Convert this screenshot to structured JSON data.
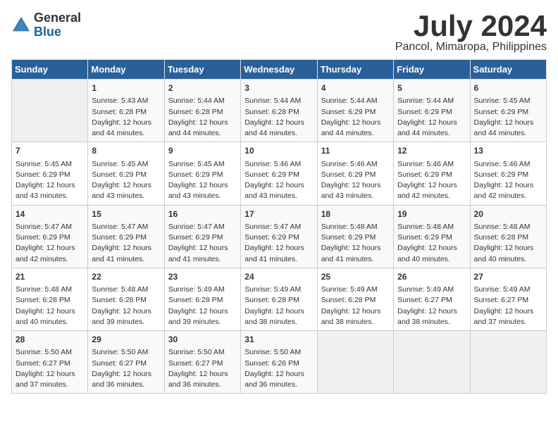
{
  "logo": {
    "general": "General",
    "blue": "Blue"
  },
  "title": "July 2024",
  "location": "Pancol, Mimaropa, Philippines",
  "days_of_week": [
    "Sunday",
    "Monday",
    "Tuesday",
    "Wednesday",
    "Thursday",
    "Friday",
    "Saturday"
  ],
  "weeks": [
    [
      {
        "day": "",
        "content": ""
      },
      {
        "day": "1",
        "content": "Sunrise: 5:43 AM\nSunset: 6:28 PM\nDaylight: 12 hours\nand 44 minutes."
      },
      {
        "day": "2",
        "content": "Sunrise: 5:44 AM\nSunset: 6:28 PM\nDaylight: 12 hours\nand 44 minutes."
      },
      {
        "day": "3",
        "content": "Sunrise: 5:44 AM\nSunset: 6:28 PM\nDaylight: 12 hours\nand 44 minutes."
      },
      {
        "day": "4",
        "content": "Sunrise: 5:44 AM\nSunset: 6:29 PM\nDaylight: 12 hours\nand 44 minutes."
      },
      {
        "day": "5",
        "content": "Sunrise: 5:44 AM\nSunset: 6:29 PM\nDaylight: 12 hours\nand 44 minutes."
      },
      {
        "day": "6",
        "content": "Sunrise: 5:45 AM\nSunset: 6:29 PM\nDaylight: 12 hours\nand 44 minutes."
      }
    ],
    [
      {
        "day": "7",
        "content": "Sunrise: 5:45 AM\nSunset: 6:29 PM\nDaylight: 12 hours\nand 43 minutes."
      },
      {
        "day": "8",
        "content": "Sunrise: 5:45 AM\nSunset: 6:29 PM\nDaylight: 12 hours\nand 43 minutes."
      },
      {
        "day": "9",
        "content": "Sunrise: 5:45 AM\nSunset: 6:29 PM\nDaylight: 12 hours\nand 43 minutes."
      },
      {
        "day": "10",
        "content": "Sunrise: 5:46 AM\nSunset: 6:29 PM\nDaylight: 12 hours\nand 43 minutes."
      },
      {
        "day": "11",
        "content": "Sunrise: 5:46 AM\nSunset: 6:29 PM\nDaylight: 12 hours\nand 43 minutes."
      },
      {
        "day": "12",
        "content": "Sunrise: 5:46 AM\nSunset: 6:29 PM\nDaylight: 12 hours\nand 42 minutes."
      },
      {
        "day": "13",
        "content": "Sunrise: 5:46 AM\nSunset: 6:29 PM\nDaylight: 12 hours\nand 42 minutes."
      }
    ],
    [
      {
        "day": "14",
        "content": "Sunrise: 5:47 AM\nSunset: 6:29 PM\nDaylight: 12 hours\nand 42 minutes."
      },
      {
        "day": "15",
        "content": "Sunrise: 5:47 AM\nSunset: 6:29 PM\nDaylight: 12 hours\nand 41 minutes."
      },
      {
        "day": "16",
        "content": "Sunrise: 5:47 AM\nSunset: 6:29 PM\nDaylight: 12 hours\nand 41 minutes."
      },
      {
        "day": "17",
        "content": "Sunrise: 5:47 AM\nSunset: 6:29 PM\nDaylight: 12 hours\nand 41 minutes."
      },
      {
        "day": "18",
        "content": "Sunrise: 5:48 AM\nSunset: 6:29 PM\nDaylight: 12 hours\nand 41 minutes."
      },
      {
        "day": "19",
        "content": "Sunrise: 5:48 AM\nSunset: 6:29 PM\nDaylight: 12 hours\nand 40 minutes."
      },
      {
        "day": "20",
        "content": "Sunrise: 5:48 AM\nSunset: 6:28 PM\nDaylight: 12 hours\nand 40 minutes."
      }
    ],
    [
      {
        "day": "21",
        "content": "Sunrise: 5:48 AM\nSunset: 6:28 PM\nDaylight: 12 hours\nand 40 minutes."
      },
      {
        "day": "22",
        "content": "Sunrise: 5:48 AM\nSunset: 6:28 PM\nDaylight: 12 hours\nand 39 minutes."
      },
      {
        "day": "23",
        "content": "Sunrise: 5:49 AM\nSunset: 6:28 PM\nDaylight: 12 hours\nand 39 minutes."
      },
      {
        "day": "24",
        "content": "Sunrise: 5:49 AM\nSunset: 6:28 PM\nDaylight: 12 hours\nand 38 minutes."
      },
      {
        "day": "25",
        "content": "Sunrise: 5:49 AM\nSunset: 6:28 PM\nDaylight: 12 hours\nand 38 minutes."
      },
      {
        "day": "26",
        "content": "Sunrise: 5:49 AM\nSunset: 6:27 PM\nDaylight: 12 hours\nand 38 minutes."
      },
      {
        "day": "27",
        "content": "Sunrise: 5:49 AM\nSunset: 6:27 PM\nDaylight: 12 hours\nand 37 minutes."
      }
    ],
    [
      {
        "day": "28",
        "content": "Sunrise: 5:50 AM\nSunset: 6:27 PM\nDaylight: 12 hours\nand 37 minutes."
      },
      {
        "day": "29",
        "content": "Sunrise: 5:50 AM\nSunset: 6:27 PM\nDaylight: 12 hours\nand 36 minutes."
      },
      {
        "day": "30",
        "content": "Sunrise: 5:50 AM\nSunset: 6:27 PM\nDaylight: 12 hours\nand 36 minutes."
      },
      {
        "day": "31",
        "content": "Sunrise: 5:50 AM\nSunset: 6:26 PM\nDaylight: 12 hours\nand 36 minutes."
      },
      {
        "day": "",
        "content": ""
      },
      {
        "day": "",
        "content": ""
      },
      {
        "day": "",
        "content": ""
      }
    ]
  ]
}
